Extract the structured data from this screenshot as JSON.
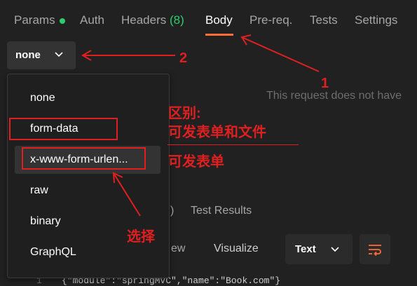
{
  "tabs": {
    "params": "Params",
    "auth": "Auth",
    "headers_label": "Headers",
    "headers_count": "(8)",
    "body": "Body",
    "prereq": "Pre-req.",
    "tests": "Tests",
    "settings": "Settings"
  },
  "body_select": {
    "value": "none"
  },
  "empty_message": "This request does not have",
  "dropdown": {
    "items": [
      "none",
      "form-data",
      "x-www-form-urlen...",
      "raw",
      "binary",
      "GraphQL"
    ]
  },
  "response": {
    "partial_paren": ")",
    "test_results": "Test Results",
    "pretty_view_partial": "ew",
    "visualize": "Visualize",
    "format_select": "Text"
  },
  "code": {
    "line_number": "1",
    "line_text": "{\"module\":\"springMVC\",\"name\":\"Book.com\"}"
  },
  "annotations": {
    "num1": "1",
    "num2": "2",
    "difference": "区别:",
    "formdata_note": "可发表单和文件",
    "urlencoded_note": "可发表单",
    "select_note": "选择"
  },
  "colors": {
    "accent": "#ff6c37",
    "count_green": "#2ecc71",
    "annotation_red": "#e02020"
  }
}
